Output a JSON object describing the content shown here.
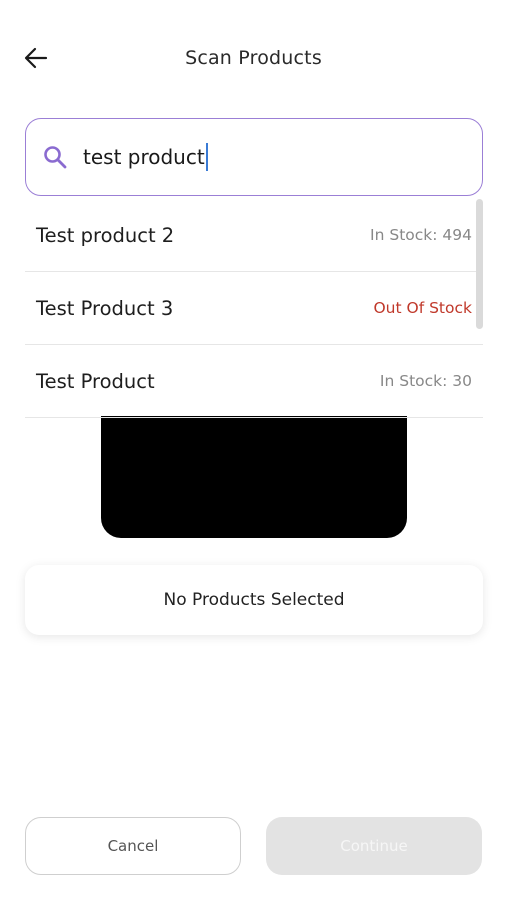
{
  "header": {
    "title": "Scan Products",
    "back_icon": "arrow-left-icon"
  },
  "search": {
    "value": "test product",
    "icon": "search-icon",
    "accent_color": "#9b7fd6"
  },
  "suggestions": [
    {
      "name": "Test product 2",
      "stock": "In Stock: 494",
      "status": "in"
    },
    {
      "name": "Test Product 3",
      "stock": "Out Of Stock",
      "status": "out"
    },
    {
      "name": "Test Product",
      "stock": "In Stock: 30",
      "status": "in"
    }
  ],
  "selected": {
    "empty_text": "No Products Selected"
  },
  "footer": {
    "cancel_label": "Cancel",
    "continue_label": "Continue"
  },
  "colors": {
    "out_of_stock": "#c0392b",
    "in_stock": "#888888"
  }
}
